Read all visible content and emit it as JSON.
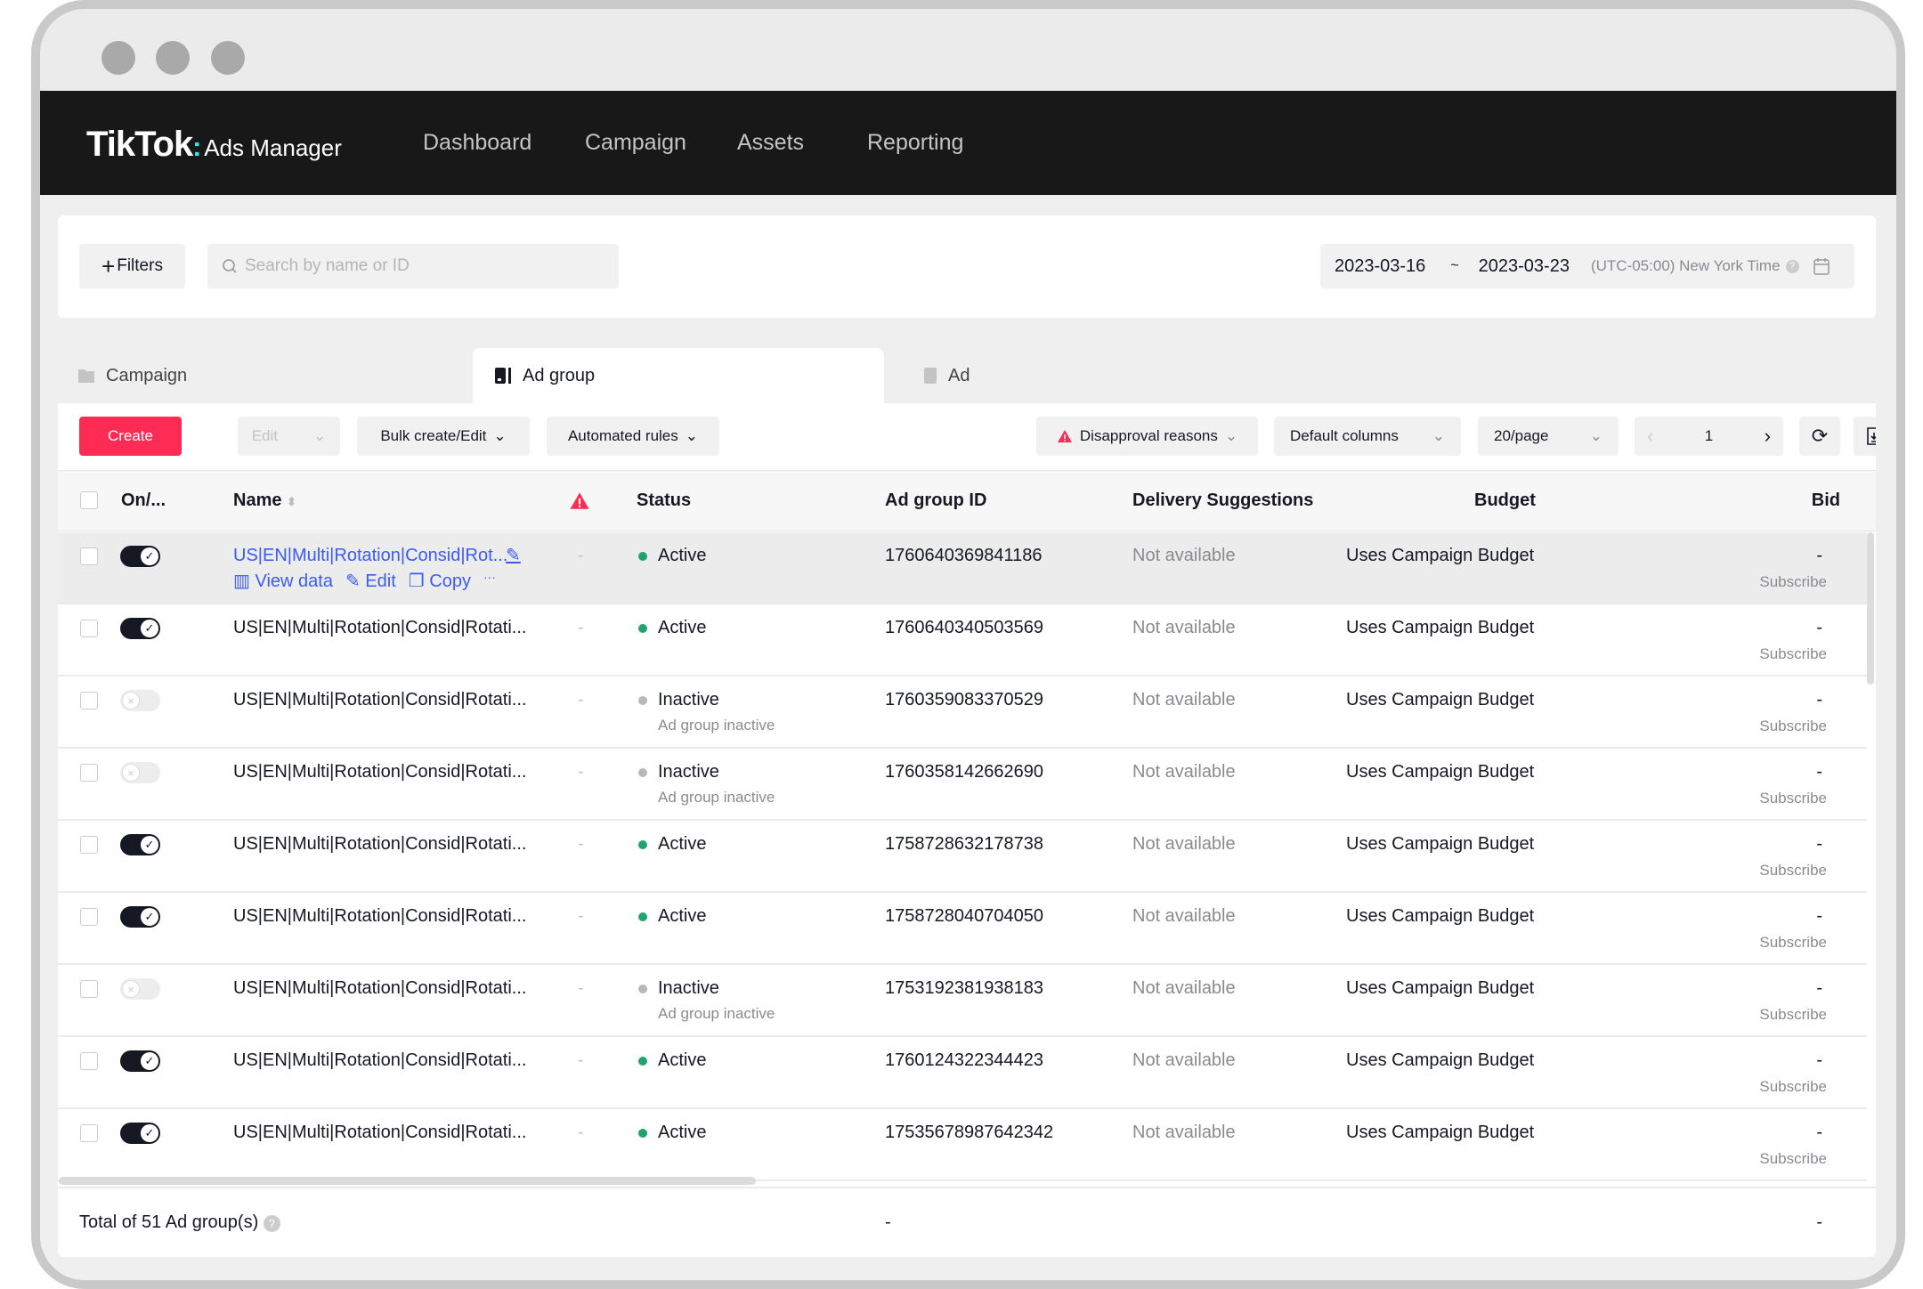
{
  "nav": {
    "logo": "TikTok",
    "logo_sub": "Ads Manager",
    "items": [
      "Dashboard",
      "Campaign",
      "Assets",
      "Reporting"
    ]
  },
  "filters": {
    "filters_label": "Filters",
    "search_placeholder": "Search by name or ID",
    "date_start": "2023-03-16",
    "date_sep": "~",
    "date_end": "2023-03-23",
    "timezone": "(UTC-05:00) New York Time"
  },
  "tabs": [
    {
      "label": "Campaign",
      "active": false
    },
    {
      "label": "Ad group",
      "active": true
    },
    {
      "label": "Ad",
      "active": false
    }
  ],
  "toolbar": {
    "create": "Create",
    "edit": "Edit",
    "bulk": "Bulk create/Edit",
    "automated": "Automated rules",
    "disapproval": "Disapproval reasons",
    "columns": "Default columns",
    "per_page": "20/page",
    "page": "1"
  },
  "colors": {
    "accent": "#fe2c55",
    "link": "#3b5bf6",
    "active": "#1fa56a",
    "inactive": "#b8b8b8",
    "nav_bg": "#181818"
  },
  "table": {
    "headers": {
      "onoff": "On/...",
      "name": "Name",
      "status": "Status",
      "id": "Ad group ID",
      "delivery": "Delivery Suggestions",
      "budget": "Budget",
      "bid": "Bid"
    },
    "hover_actions": {
      "view": "View data",
      "edit": "Edit",
      "copy": "Copy",
      "more": "···"
    },
    "rows": [
      {
        "name": "US|EN|Multi|Rotation|Consid|Rot...",
        "hover": true,
        "on": true,
        "warn": "-",
        "status": "Active",
        "status_sub": "",
        "id": "1760640369841186",
        "delivery": "Not available",
        "budget": "Uses Campaign Budget",
        "bid": "-",
        "bid_sub": "Subscribe"
      },
      {
        "name": "US|EN|Multi|Rotation|Consid|Rotati...",
        "hover": false,
        "on": true,
        "warn": "-",
        "status": "Active",
        "status_sub": "",
        "id": "1760640340503569",
        "delivery": "Not available",
        "budget": "Uses Campaign Budget",
        "bid": "-",
        "bid_sub": "Subscribe"
      },
      {
        "name": "US|EN|Multi|Rotation|Consid|Rotati...",
        "hover": false,
        "on": false,
        "warn": "-",
        "status": "Inactive",
        "status_sub": "Ad group inactive",
        "id": "1760359083370529",
        "delivery": "Not available",
        "budget": "Uses Campaign Budget",
        "bid": "-",
        "bid_sub": "Subscribe"
      },
      {
        "name": "US|EN|Multi|Rotation|Consid|Rotati...",
        "hover": false,
        "on": false,
        "warn": "-",
        "status": "Inactive",
        "status_sub": "Ad group inactive",
        "id": "1760358142662690",
        "delivery": "Not available",
        "budget": "Uses Campaign Budget",
        "bid": "-",
        "bid_sub": "Subscribe"
      },
      {
        "name": "US|EN|Multi|Rotation|Consid|Rotati...",
        "hover": false,
        "on": true,
        "warn": "-",
        "status": "Active",
        "status_sub": "",
        "id": "1758728632178738",
        "delivery": "Not available",
        "budget": "Uses Campaign Budget",
        "bid": "-",
        "bid_sub": "Subscribe"
      },
      {
        "name": "US|EN|Multi|Rotation|Consid|Rotati...",
        "hover": false,
        "on": true,
        "warn": "-",
        "status": "Active",
        "status_sub": "",
        "id": "1758728040704050",
        "delivery": "Not available",
        "budget": "Uses Campaign Budget",
        "bid": "-",
        "bid_sub": "Subscribe"
      },
      {
        "name": "US|EN|Multi|Rotation|Consid|Rotati...",
        "hover": false,
        "on": false,
        "warn": "-",
        "status": "Inactive",
        "status_sub": "Ad group inactive",
        "id": "1753192381938183",
        "delivery": "Not available",
        "budget": "Uses Campaign Budget",
        "bid": "-",
        "bid_sub": "Subscribe"
      },
      {
        "name": "US|EN|Multi|Rotation|Consid|Rotati...",
        "hover": false,
        "on": true,
        "warn": "-",
        "status": "Active",
        "status_sub": "",
        "id": "1760124322344423",
        "delivery": "Not available",
        "budget": "Uses Campaign Budget",
        "bid": "-",
        "bid_sub": "Subscribe"
      },
      {
        "name": "US|EN|Multi|Rotation|Consid|Rotati...",
        "hover": false,
        "on": true,
        "warn": "-",
        "status": "Active",
        "status_sub": "",
        "id": "17535678987642342",
        "delivery": "Not available",
        "budget": "Uses Campaign Budget",
        "bid": "-",
        "bid_sub": "Subscribe"
      }
    ],
    "footer": {
      "total": "Total of 51 Ad group(s)",
      "id": "-",
      "bid": "-"
    }
  }
}
